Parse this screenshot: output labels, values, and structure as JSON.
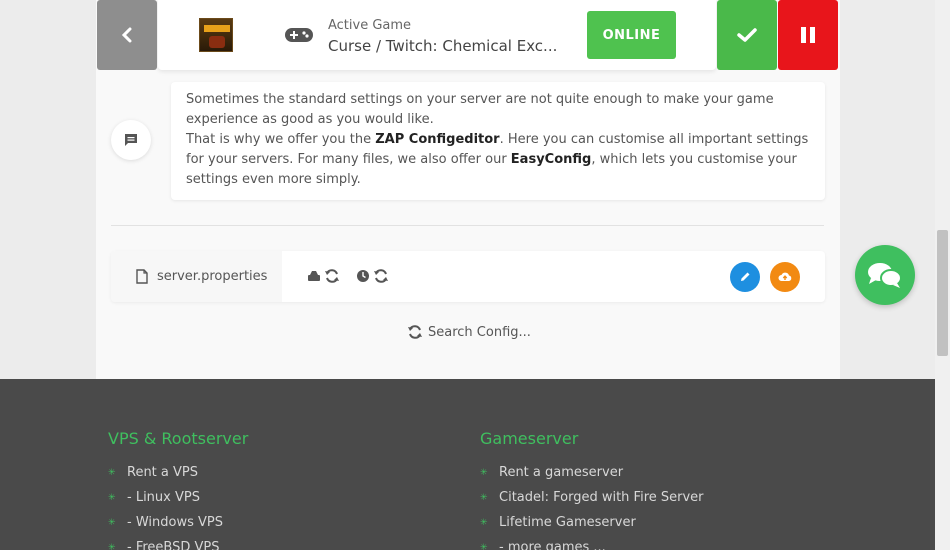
{
  "topbar": {
    "game_label": "Active Game",
    "game_title": "Curse / Twitch: Chemical Exc...",
    "status_label": "ONLINE",
    "colors": {
      "online": "#4fc24f",
      "check": "#4ab94a",
      "pause": "#e8151b",
      "back": "#8e8e8e"
    }
  },
  "info": {
    "line1": "Sometimes the standard settings on your server are not quite enough to make your game experience as good as you would like.",
    "line2_pre": "That is why we offer you the ",
    "line2_bold": "ZAP Configeditor",
    "line2_mid": ". Here you can customise all important settings for your servers. For many files, we also offer our ",
    "line2_bold2": "EasyConfig",
    "line2_post": ", which lets you customise your settings even more simply."
  },
  "config": {
    "file_name": "server.properties",
    "search_label": "Search Config..."
  },
  "footer": {
    "col1": {
      "title": "VPS & Rootserver",
      "items": [
        "Rent a VPS",
        "- Linux VPS",
        "- Windows VPS",
        "- FreeBSD VPS"
      ]
    },
    "col2": {
      "title": "Gameserver",
      "items": [
        "Rent a gameserver",
        "Citadel: Forged with Fire Server",
        "Lifetime Gameserver",
        "- more games ..."
      ]
    }
  }
}
